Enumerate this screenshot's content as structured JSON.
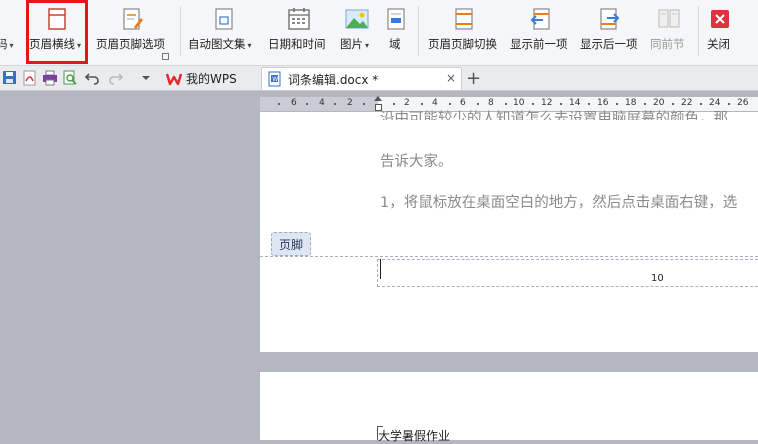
{
  "ribbon": {
    "partial_left_label": "码",
    "buttons": [
      {
        "label": "页眉横线",
        "icon": "header-line-icon",
        "has_dropdown": true
      },
      {
        "label": "页眉页脚选项",
        "icon": "header-footer-options-icon",
        "has_dropdown": false
      },
      {
        "label": "自动图文集",
        "icon": "autotext-icon",
        "has_dropdown": true
      },
      {
        "label": "日期和时间",
        "icon": "calendar-icon",
        "has_dropdown": false
      },
      {
        "label": "图片",
        "icon": "picture-icon",
        "has_dropdown": true
      },
      {
        "label": "域",
        "icon": "field-icon",
        "has_dropdown": false
      },
      {
        "label": "页眉页脚切换",
        "icon": "header-footer-switch-icon",
        "has_dropdown": false
      },
      {
        "label": "显示前一项",
        "icon": "show-previous-icon",
        "has_dropdown": false
      },
      {
        "label": "显示后一项",
        "icon": "show-next-icon",
        "has_dropdown": false
      },
      {
        "label": "同前节",
        "icon": "same-as-previous-icon",
        "has_dropdown": false,
        "disabled": true
      },
      {
        "label": "关闭",
        "icon": "close-red-icon",
        "has_dropdown": false
      }
    ],
    "highlight_color": "#e8131b"
  },
  "tabs": {
    "wps_label": "我的WPS",
    "doc_label": "词条编辑.docx *",
    "new_tab": "+",
    "close_glyph": "×"
  },
  "ruler": {
    "labels": [
      "6",
      "4",
      "2",
      "2",
      "4",
      "6",
      "8",
      "10",
      "12",
      "14",
      "16",
      "18",
      "20",
      "22",
      "24",
      "26"
    ]
  },
  "document": {
    "line_cut": "沿中可能较少的人知道怎么去设置电脑屏幕的颜色，那",
    "line2": "告诉大家。",
    "line3": "1，将鼠标放在桌面空白的地方，然后点击桌面右键，选",
    "footer_label": "页脚",
    "page_number": "10",
    "page2_header": "大学暑假作业"
  },
  "colors": {
    "accent_red": "#e8131b",
    "canvas": "#b4b7bf",
    "wps_red": "#e5262d"
  }
}
